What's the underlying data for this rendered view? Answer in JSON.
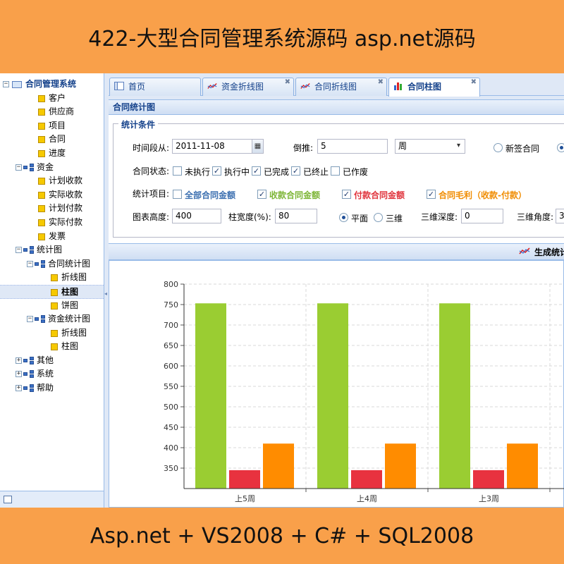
{
  "banner": {
    "title": "422-大型合同管理系统源码 asp.net源码",
    "footer": "Asp.net + VS2008 + C# + SQL2008"
  },
  "sidebar": {
    "root": "合同管理系统",
    "items": [
      {
        "label": "客户",
        "level": 1,
        "kind": "leaf"
      },
      {
        "label": "供应商",
        "level": 1,
        "kind": "leaf"
      },
      {
        "label": "项目",
        "level": 1,
        "kind": "leaf"
      },
      {
        "label": "合同",
        "level": 1,
        "kind": "leaf"
      },
      {
        "label": "进度",
        "level": 1,
        "kind": "leaf"
      },
      {
        "label": "资金",
        "level": 1,
        "kind": "folder",
        "expanded": true
      },
      {
        "label": "计划收款",
        "level": 2,
        "kind": "leaf"
      },
      {
        "label": "实际收款",
        "level": 2,
        "kind": "leaf"
      },
      {
        "label": "计划付款",
        "level": 2,
        "kind": "leaf"
      },
      {
        "label": "实际付款",
        "level": 2,
        "kind": "leaf"
      },
      {
        "label": "发票",
        "level": 2,
        "kind": "leaf"
      },
      {
        "label": "统计图",
        "level": 1,
        "kind": "folder",
        "expanded": true
      },
      {
        "label": "合同统计图",
        "level": 2,
        "kind": "folder",
        "expanded": true
      },
      {
        "label": "折线图",
        "level": 3,
        "kind": "leaf"
      },
      {
        "label": "柱图",
        "level": 3,
        "kind": "leaf",
        "selected": true
      },
      {
        "label": "饼图",
        "level": 3,
        "kind": "leaf"
      },
      {
        "label": "资金统计图",
        "level": 2,
        "kind": "folder",
        "expanded": true
      },
      {
        "label": "折线图",
        "level": 3,
        "kind": "leaf"
      },
      {
        "label": "柱图",
        "level": 3,
        "kind": "leaf"
      },
      {
        "label": "其他",
        "level": 1,
        "kind": "folder",
        "expanded": false
      },
      {
        "label": "系统",
        "level": 1,
        "kind": "folder",
        "expanded": false
      },
      {
        "label": "帮助",
        "level": 1,
        "kind": "folder",
        "expanded": false
      }
    ]
  },
  "tabs": [
    {
      "label": "首页",
      "icon": "home-icon",
      "closable": false,
      "active": false
    },
    {
      "label": "资金折线图",
      "icon": "line-chart-icon",
      "closable": true,
      "active": false
    },
    {
      "label": "合同折线图",
      "icon": "line-chart-icon",
      "closable": true,
      "active": false
    },
    {
      "label": "合同柱图",
      "icon": "bar-chart-icon",
      "closable": true,
      "active": true
    }
  ],
  "panel_title": "合同统计图",
  "form": {
    "legend": "统计条件",
    "time_label": "时间段从:",
    "date_value": "2011-11-08",
    "back_label": "倒推:",
    "back_value": "5",
    "unit_value": "周",
    "type_options": [
      {
        "label": "新签合同",
        "checked": false
      }
    ],
    "status_label": "合同状态:",
    "statuses": [
      {
        "label": "未执行",
        "checked": false
      },
      {
        "label": "执行中",
        "checked": true
      },
      {
        "label": "已完成",
        "checked": true
      },
      {
        "label": "已终止",
        "checked": true
      },
      {
        "label": "已作废",
        "checked": false
      }
    ],
    "items_label": "统计项目:",
    "items": [
      {
        "label": "全部合同金额",
        "checked": false,
        "color": "#3b6fb0"
      },
      {
        "label": "收款合同金额",
        "checked": true,
        "color": "#7db536"
      },
      {
        "label": "付款合同金额",
        "checked": true,
        "color": "#e0333c"
      },
      {
        "label": "合同毛利（收款-付款）",
        "checked": true,
        "color": "#f08c00"
      }
    ],
    "height_label": "图表高度:",
    "height_value": "400",
    "barwidth_label": "柱宽度(%):",
    "barwidth_value": "80",
    "view_options": [
      {
        "label": "平面",
        "checked": true
      },
      {
        "label": "三维",
        "checked": false
      }
    ],
    "depth_label": "三维深度:",
    "depth_value": "0",
    "angle_label": "三维角度:",
    "angle_value": "3"
  },
  "generate_label": "生成统计",
  "chart_data": {
    "type": "bar",
    "categories": [
      "上5周",
      "上4周",
      "上3周"
    ],
    "series": [
      {
        "values": [
          753,
          753,
          753
        ],
        "color": "#9acd32"
      },
      {
        "values": [
          345,
          345,
          345
        ],
        "color": "#e8323f"
      },
      {
        "values": [
          410,
          410,
          410
        ],
        "color": "#ff8c00"
      }
    ],
    "ylim": [
      300,
      800
    ],
    "yticks": [
      350,
      400,
      450,
      500,
      550,
      600,
      650,
      700,
      750,
      800
    ],
    "grid": true
  }
}
